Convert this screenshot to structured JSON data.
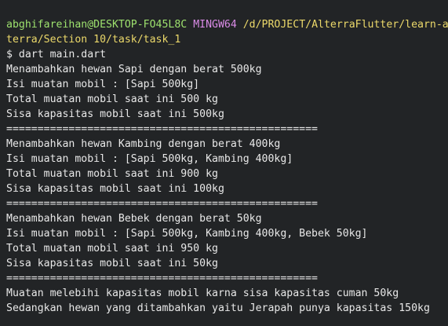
{
  "prompt": {
    "user_host": "abghifareihan@DESKTOP-FO45L8C",
    "env": "MINGW64",
    "path_part1": "/d/PROJECT/AlterraFlutter/learn-al",
    "path_part2": "terra/Section 10/task/task_1"
  },
  "command": "$ dart main.dart",
  "output": [
    "Menambahkan hewan Sapi dengan berat 500kg",
    "Isi muatan mobil : [Sapi 500kg]",
    "Total muatan mobil saat ini 500 kg",
    "Sisa kapasitas mobil saat ini 500kg",
    "==================================================",
    "Menambahkan hewan Kambing dengan berat 400kg",
    "Isi muatan mobil : [Sapi 500kg, Kambing 400kg]",
    "Total muatan mobil saat ini 900 kg",
    "Sisa kapasitas mobil saat ini 100kg",
    "==================================================",
    "Menambahkan hewan Bebek dengan berat 50kg",
    "Isi muatan mobil : [Sapi 500kg, Kambing 400kg, Bebek 50kg]",
    "Total muatan mobil saat ini 950 kg",
    "Sisa kapasitas mobil saat ini 50kg",
    "==================================================",
    "Muatan melebihi kapasitas mobil karna sisa kapasitas cuman 50kg",
    "Sedangkan hewan yang ditambahkan yaitu Jerapah punya kapasitas 150kg"
  ]
}
